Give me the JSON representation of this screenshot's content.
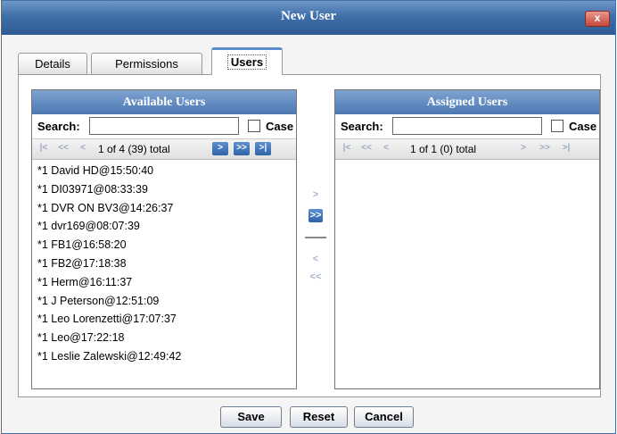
{
  "dialog": {
    "title": "New User",
    "close_label": "x"
  },
  "tabs": [
    {
      "label": "Details"
    },
    {
      "label": "Permissions"
    },
    {
      "label": "Users"
    }
  ],
  "available": {
    "header": "Available Users",
    "search_label": "Search:",
    "search_value": "",
    "case_label": "Case",
    "pager_text": "1 of 4 (39) total",
    "items": [
      "*1 David HD@15:50:40",
      "*1 DI03971@08:33:39",
      "*1 DVR ON BV3@14:26:37",
      "*1 dvr169@08:07:39",
      "*1 FB1@16:58:20",
      "*1 FB2@17:18:38",
      "*1 Herm@16:11:37",
      "*1 J Peterson@12:51:09",
      "*1 Leo Lorenzetti@17:07:37",
      "*1 Leo@17:22:18",
      "*1 Leslie Zalewski@12:49:42"
    ]
  },
  "assigned": {
    "header": "Assigned Users",
    "search_label": "Search:",
    "search_value": "",
    "case_label": "Case",
    "pager_text": "1 of 1 (0) total",
    "items": []
  },
  "pager_icons": {
    "first": "|<",
    "prev_fast": "<<",
    "prev": "<",
    "next": ">",
    "next_fast": ">>",
    "last": ">|"
  },
  "move_icons": {
    "add": ">",
    "add_all": ">>",
    "remove": "<",
    "remove_all": "<<"
  },
  "buttons": {
    "save": "Save",
    "reset": "Reset",
    "cancel": "Cancel"
  }
}
